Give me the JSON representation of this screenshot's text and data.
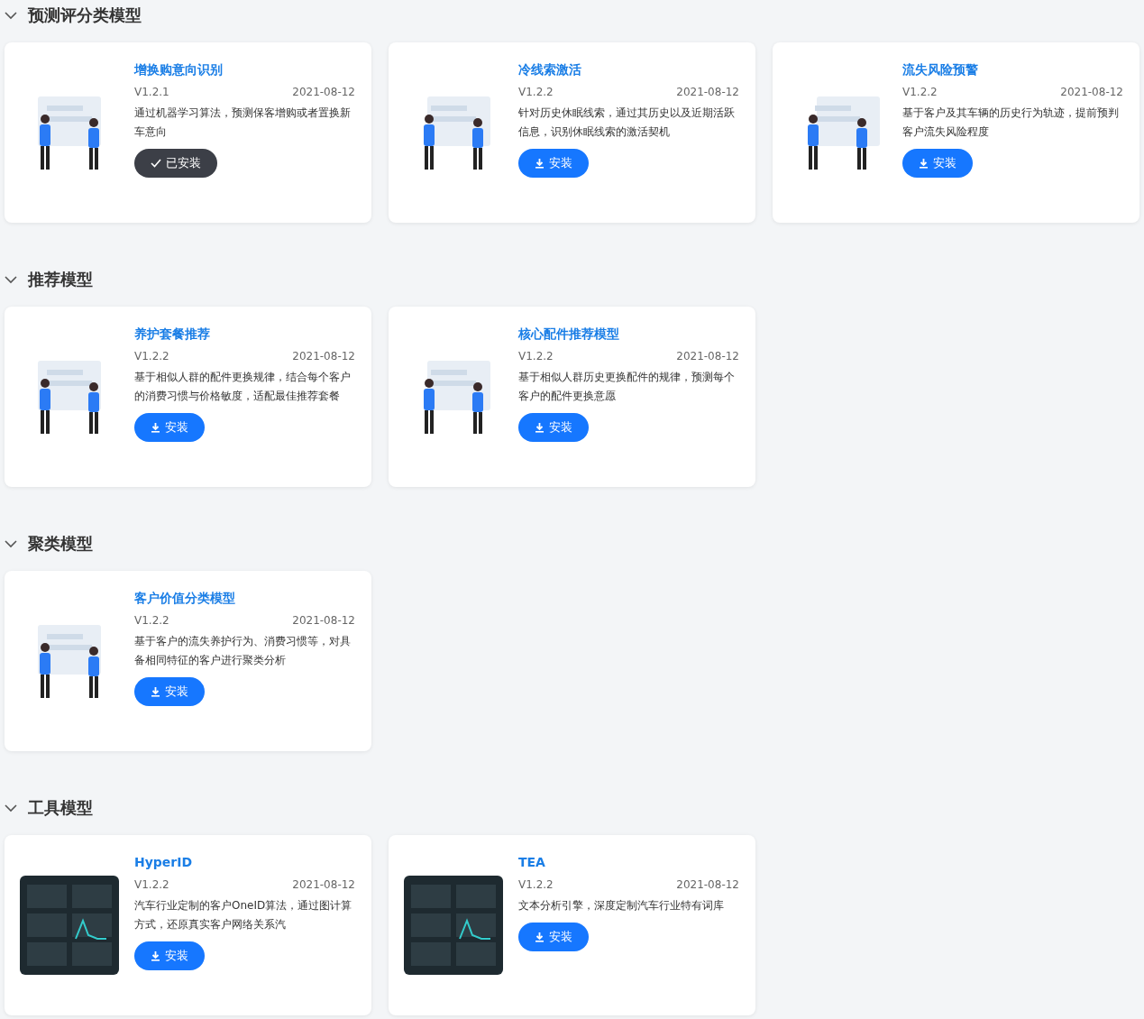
{
  "sections": [
    {
      "title": "预测评分类模型",
      "expanded": true,
      "models": [
        {
          "title": "增换购意向识别",
          "version": "V1.2.1",
          "date": "2021-08-12",
          "description": "通过机器学习算法，预测保客增购或者置换新车意向",
          "installed": true,
          "button": "已安装",
          "kind": "illustration"
        },
        {
          "title": "冷线索激活",
          "version": "V1.2.2",
          "date": "2021-08-12",
          "description": "针对历史休眠线索，通过其历史以及近期活跃信息，识别休眠线索的激活契机",
          "installed": false,
          "button": "安装",
          "kind": "illustration"
        },
        {
          "title": "流失风险预警",
          "version": "V1.2.2",
          "date": "2021-08-12",
          "description": "基于客户及其车辆的历史行为轨迹，提前预判客户流失风险程度",
          "installed": false,
          "button": "安装",
          "kind": "illustration"
        }
      ]
    },
    {
      "title": "推荐模型",
      "expanded": true,
      "models": [
        {
          "title": "养护套餐推荐",
          "version": "V1.2.2",
          "date": "2021-08-12",
          "description": "基于相似人群的配件更换规律，结合每个客户的消费习惯与价格敏度，适配最佳推荐套餐",
          "installed": false,
          "button": "安装",
          "kind": "illustration"
        },
        {
          "title": "核心配件推荐模型",
          "version": "V1.2.2",
          "date": "2021-08-12",
          "description": "基于相似人群历史更换配件的规律，预测每个客户的配件更换意愿",
          "installed": false,
          "button": "安装",
          "kind": "illustration"
        }
      ]
    },
    {
      "title": "聚类模型",
      "expanded": true,
      "models": [
        {
          "title": "客户价值分类模型",
          "version": "V1.2.2",
          "date": "2021-08-12",
          "description": "基于客户的流失养护行为、消费习惯等，对具备相同特征的客户进行聚类分析",
          "installed": false,
          "button": "安装",
          "kind": "illustration"
        }
      ]
    },
    {
      "title": "工具模型",
      "expanded": true,
      "models": [
        {
          "title": "HyperID",
          "version": "V1.2.2",
          "date": "2021-08-12",
          "description": "汽车行业定制的客户OneID算法，通过图计算方式，还原真实客户网络关系汽",
          "installed": false,
          "button": "安装",
          "kind": "screenshot"
        },
        {
          "title": "TEA",
          "version": "V1.2.2",
          "date": "2021-08-12",
          "description": "文本分析引擎，深度定制汽车行业特有词库",
          "installed": false,
          "button": "安装",
          "kind": "screenshot"
        }
      ]
    }
  ]
}
